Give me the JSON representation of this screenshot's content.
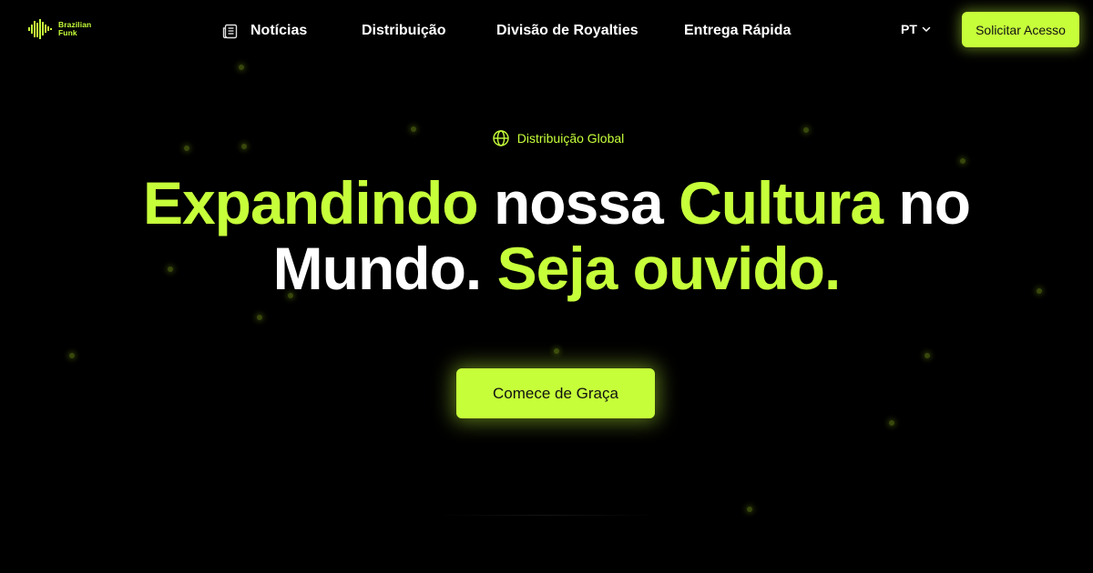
{
  "brand": {
    "line1": "Brazilian",
    "line2": "Funk",
    "accent": "#c6ff3a"
  },
  "nav": {
    "items": [
      {
        "label": "Notícias",
        "icon": "newspaper-icon"
      },
      {
        "label": "Distribuição"
      },
      {
        "label": "Divisão de Royalties"
      },
      {
        "label": "Entrega Rápida"
      }
    ],
    "language": "PT",
    "language_icon": "chevron-down-icon",
    "cta_label": "Solicitar Acesso"
  },
  "hero": {
    "badge_label": "Distribuição Global",
    "badge_icon": "globe-icon",
    "headline": {
      "w1": "Expandindo",
      "w2": "nossa",
      "w3": "Cultura",
      "w4": "no",
      "w5": "Mundo.",
      "w6": "Seja ouvido."
    },
    "cta_label": "Comece de Graça"
  },
  "colors": {
    "background": "#000000",
    "accent": "#c6ff3a",
    "text": "#ffffff"
  }
}
